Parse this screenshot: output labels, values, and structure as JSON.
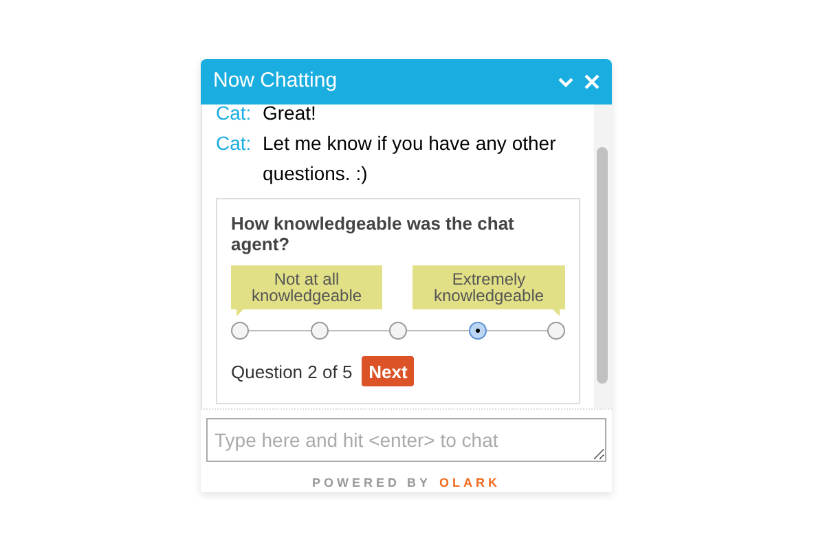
{
  "header": {
    "title": "Now Chatting"
  },
  "messages": [
    {
      "sender": "Cat:",
      "text": "Great!"
    },
    {
      "sender": "Cat:",
      "text": "Let me know if you have any other questions. :)"
    }
  ],
  "survey": {
    "question": "How knowledgeable was the chat agent?",
    "low_label": "Not at all knowledgeable",
    "high_label": "Extremely knowledgeable",
    "options": [
      {
        "selected": false
      },
      {
        "selected": false
      },
      {
        "selected": false
      },
      {
        "selected": true
      },
      {
        "selected": false
      }
    ],
    "progress": "Question 2 of 5",
    "next_button": "Next"
  },
  "input": {
    "placeholder": "Type here and hit <enter> to chat"
  },
  "footer": {
    "powered_by": "POWERED BY",
    "brand": "OLARK"
  }
}
